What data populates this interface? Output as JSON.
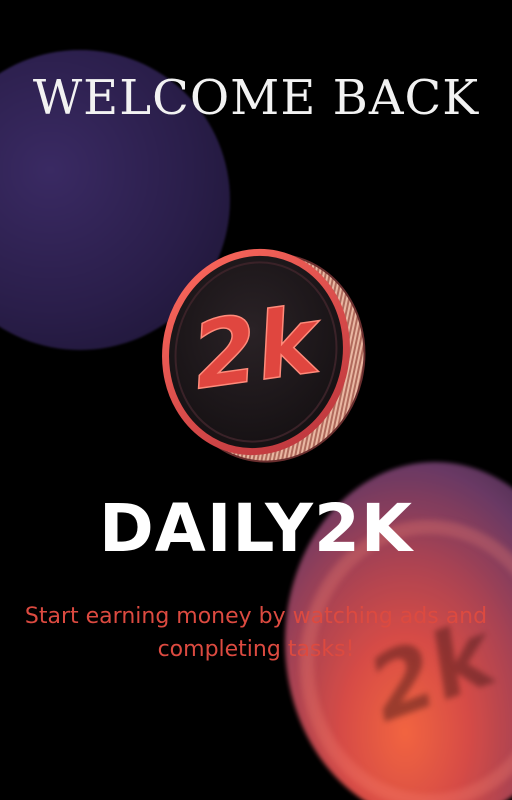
{
  "header": {
    "title": "WELCOME BACK"
  },
  "logo": {
    "coin_text": "2k",
    "icon": "coin-2k-icon"
  },
  "brand": {
    "name": "DAILY2K"
  },
  "tagline": {
    "text": "Start earning money by watching ads and completing tasks!"
  },
  "colors": {
    "background": "#000000",
    "accent": "#dc4a40",
    "title": "#f2f2f2",
    "brand": "#ffffff"
  }
}
